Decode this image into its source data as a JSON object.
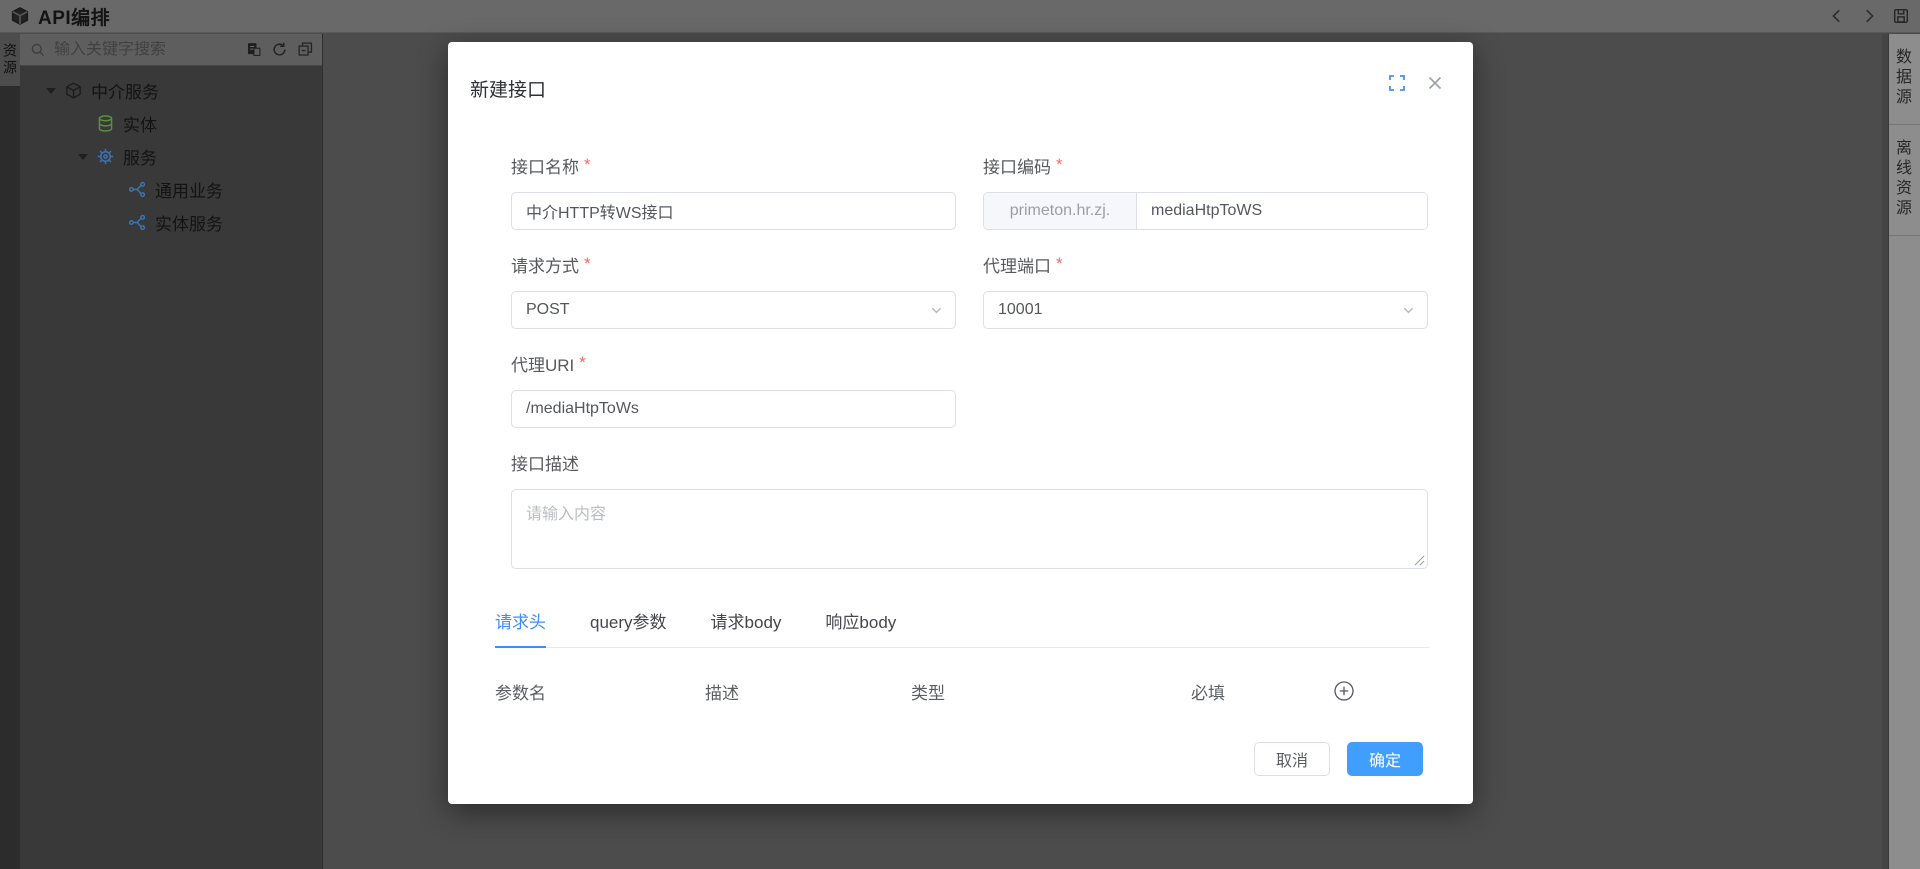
{
  "app": {
    "title": "API编排"
  },
  "topbar": {
    "icons": {
      "back": "chevron-left",
      "forward": "chevron-right",
      "save": "floppy-disk"
    }
  },
  "left_panel_tab": "资源",
  "sidebar": {
    "search_placeholder": "输入关键字搜索",
    "toolbar_icons": {
      "batch": "document-badge",
      "refresh": "circular-arrow",
      "collapse": "overlapping-panels"
    },
    "tree": [
      {
        "label": "中介服务",
        "icon": "cube",
        "level": 0,
        "expanded": true
      },
      {
        "label": "实体",
        "icon": "database",
        "level": 1
      },
      {
        "label": "服务",
        "icon": "gear",
        "level": 1,
        "expanded": true
      },
      {
        "label": "通用业务",
        "icon": "flow-node",
        "level": 2
      },
      {
        "label": "实体服务",
        "icon": "flow-node",
        "level": 2
      }
    ]
  },
  "right_tabs": [
    "数据源",
    "离线资源"
  ],
  "modal": {
    "title": "新建接口",
    "required_mark": "*",
    "fields": {
      "name": {
        "label": "接口名称",
        "value": "中介HTTP转WS接口"
      },
      "code": {
        "label": "接口编码",
        "prefix": "primeton.hr.zj.",
        "value": "mediaHtpToWS"
      },
      "method": {
        "label": "请求方式",
        "value": "POST"
      },
      "port": {
        "label": "代理端口",
        "value": "10001"
      },
      "uri": {
        "label": "代理URI",
        "value": "/mediaHtpToWs"
      },
      "desc": {
        "label": "接口描述",
        "placeholder": "请输入内容"
      }
    },
    "tabs": [
      {
        "label": "请求头"
      },
      {
        "label": "query参数"
      },
      {
        "label": "请求body"
      },
      {
        "label": "响应body"
      }
    ],
    "table_headers": [
      "参数名",
      "描述",
      "类型",
      "必填"
    ],
    "buttons": {
      "cancel": "取消",
      "ok": "确定"
    }
  },
  "colors": {
    "accent": "#409eff",
    "required": "#f56c6c",
    "overlay_canvas": "#4c4c4c",
    "tree_green": "#5a9140",
    "tree_blue": "#3a76b4"
  }
}
